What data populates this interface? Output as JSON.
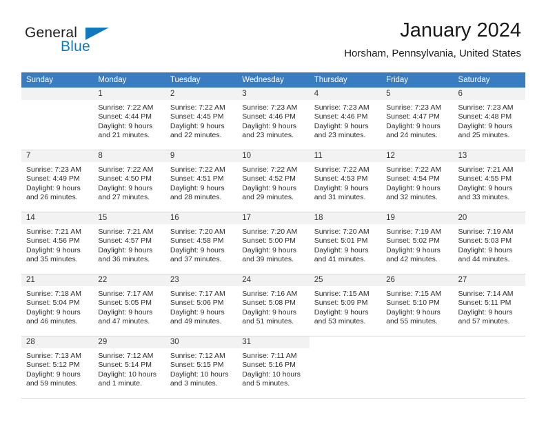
{
  "brand": {
    "name_part1": "General",
    "name_part2": "Blue",
    "accent_color": "#1278be"
  },
  "header": {
    "month_title": "January 2024",
    "location": "Horsham, Pennsylvania, United States"
  },
  "theme": {
    "header_row_color": "#3a7cc0",
    "daynum_bar_color": "#f2f2f2",
    "grid_line_color": "#d9d9d9"
  },
  "weekday_headers": [
    "Sunday",
    "Monday",
    "Tuesday",
    "Wednesday",
    "Thursday",
    "Friday",
    "Saturday"
  ],
  "weeks": [
    [
      {
        "day": "",
        "sunrise": "",
        "sunset": "",
        "daylight": "",
        "empty": true
      },
      {
        "day": "1",
        "sunrise": "Sunrise: 7:22 AM",
        "sunset": "Sunset: 4:44 PM",
        "daylight": "Daylight: 9 hours and 21 minutes."
      },
      {
        "day": "2",
        "sunrise": "Sunrise: 7:22 AM",
        "sunset": "Sunset: 4:45 PM",
        "daylight": "Daylight: 9 hours and 22 minutes."
      },
      {
        "day": "3",
        "sunrise": "Sunrise: 7:23 AM",
        "sunset": "Sunset: 4:46 PM",
        "daylight": "Daylight: 9 hours and 23 minutes."
      },
      {
        "day": "4",
        "sunrise": "Sunrise: 7:23 AM",
        "sunset": "Sunset: 4:46 PM",
        "daylight": "Daylight: 9 hours and 23 minutes."
      },
      {
        "day": "5",
        "sunrise": "Sunrise: 7:23 AM",
        "sunset": "Sunset: 4:47 PM",
        "daylight": "Daylight: 9 hours and 24 minutes."
      },
      {
        "day": "6",
        "sunrise": "Sunrise: 7:23 AM",
        "sunset": "Sunset: 4:48 PM",
        "daylight": "Daylight: 9 hours and 25 minutes."
      }
    ],
    [
      {
        "day": "7",
        "sunrise": "Sunrise: 7:23 AM",
        "sunset": "Sunset: 4:49 PM",
        "daylight": "Daylight: 9 hours and 26 minutes."
      },
      {
        "day": "8",
        "sunrise": "Sunrise: 7:22 AM",
        "sunset": "Sunset: 4:50 PM",
        "daylight": "Daylight: 9 hours and 27 minutes."
      },
      {
        "day": "9",
        "sunrise": "Sunrise: 7:22 AM",
        "sunset": "Sunset: 4:51 PM",
        "daylight": "Daylight: 9 hours and 28 minutes."
      },
      {
        "day": "10",
        "sunrise": "Sunrise: 7:22 AM",
        "sunset": "Sunset: 4:52 PM",
        "daylight": "Daylight: 9 hours and 29 minutes."
      },
      {
        "day": "11",
        "sunrise": "Sunrise: 7:22 AM",
        "sunset": "Sunset: 4:53 PM",
        "daylight": "Daylight: 9 hours and 31 minutes."
      },
      {
        "day": "12",
        "sunrise": "Sunrise: 7:22 AM",
        "sunset": "Sunset: 4:54 PM",
        "daylight": "Daylight: 9 hours and 32 minutes."
      },
      {
        "day": "13",
        "sunrise": "Sunrise: 7:21 AM",
        "sunset": "Sunset: 4:55 PM",
        "daylight": "Daylight: 9 hours and 33 minutes."
      }
    ],
    [
      {
        "day": "14",
        "sunrise": "Sunrise: 7:21 AM",
        "sunset": "Sunset: 4:56 PM",
        "daylight": "Daylight: 9 hours and 35 minutes."
      },
      {
        "day": "15",
        "sunrise": "Sunrise: 7:21 AM",
        "sunset": "Sunset: 4:57 PM",
        "daylight": "Daylight: 9 hours and 36 minutes."
      },
      {
        "day": "16",
        "sunrise": "Sunrise: 7:20 AM",
        "sunset": "Sunset: 4:58 PM",
        "daylight": "Daylight: 9 hours and 37 minutes."
      },
      {
        "day": "17",
        "sunrise": "Sunrise: 7:20 AM",
        "sunset": "Sunset: 5:00 PM",
        "daylight": "Daylight: 9 hours and 39 minutes."
      },
      {
        "day": "18",
        "sunrise": "Sunrise: 7:20 AM",
        "sunset": "Sunset: 5:01 PM",
        "daylight": "Daylight: 9 hours and 41 minutes."
      },
      {
        "day": "19",
        "sunrise": "Sunrise: 7:19 AM",
        "sunset": "Sunset: 5:02 PM",
        "daylight": "Daylight: 9 hours and 42 minutes."
      },
      {
        "day": "20",
        "sunrise": "Sunrise: 7:19 AM",
        "sunset": "Sunset: 5:03 PM",
        "daylight": "Daylight: 9 hours and 44 minutes."
      }
    ],
    [
      {
        "day": "21",
        "sunrise": "Sunrise: 7:18 AM",
        "sunset": "Sunset: 5:04 PM",
        "daylight": "Daylight: 9 hours and 46 minutes."
      },
      {
        "day": "22",
        "sunrise": "Sunrise: 7:17 AM",
        "sunset": "Sunset: 5:05 PM",
        "daylight": "Daylight: 9 hours and 47 minutes."
      },
      {
        "day": "23",
        "sunrise": "Sunrise: 7:17 AM",
        "sunset": "Sunset: 5:06 PM",
        "daylight": "Daylight: 9 hours and 49 minutes."
      },
      {
        "day": "24",
        "sunrise": "Sunrise: 7:16 AM",
        "sunset": "Sunset: 5:08 PM",
        "daylight": "Daylight: 9 hours and 51 minutes."
      },
      {
        "day": "25",
        "sunrise": "Sunrise: 7:15 AM",
        "sunset": "Sunset: 5:09 PM",
        "daylight": "Daylight: 9 hours and 53 minutes."
      },
      {
        "day": "26",
        "sunrise": "Sunrise: 7:15 AM",
        "sunset": "Sunset: 5:10 PM",
        "daylight": "Daylight: 9 hours and 55 minutes."
      },
      {
        "day": "27",
        "sunrise": "Sunrise: 7:14 AM",
        "sunset": "Sunset: 5:11 PM",
        "daylight": "Daylight: 9 hours and 57 minutes."
      }
    ],
    [
      {
        "day": "28",
        "sunrise": "Sunrise: 7:13 AM",
        "sunset": "Sunset: 5:12 PM",
        "daylight": "Daylight: 9 hours and 59 minutes."
      },
      {
        "day": "29",
        "sunrise": "Sunrise: 7:12 AM",
        "sunset": "Sunset: 5:14 PM",
        "daylight": "Daylight: 10 hours and 1 minute."
      },
      {
        "day": "30",
        "sunrise": "Sunrise: 7:12 AM",
        "sunset": "Sunset: 5:15 PM",
        "daylight": "Daylight: 10 hours and 3 minutes."
      },
      {
        "day": "31",
        "sunrise": "Sunrise: 7:11 AM",
        "sunset": "Sunset: 5:16 PM",
        "daylight": "Daylight: 10 hours and 5 minutes."
      },
      {
        "day": "",
        "sunrise": "",
        "sunset": "",
        "daylight": "",
        "empty": true,
        "blank": true
      },
      {
        "day": "",
        "sunrise": "",
        "sunset": "",
        "daylight": "",
        "empty": true,
        "blank": true
      },
      {
        "day": "",
        "sunrise": "",
        "sunset": "",
        "daylight": "",
        "empty": true,
        "blank": true
      }
    ]
  ]
}
